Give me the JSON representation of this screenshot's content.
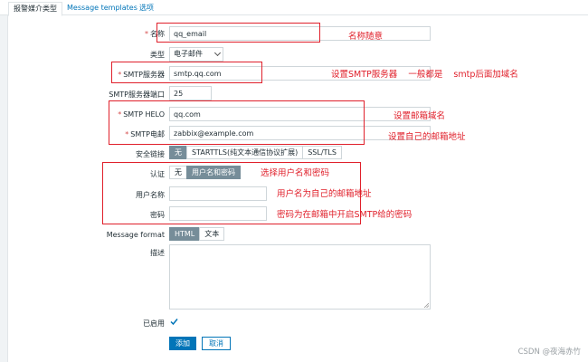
{
  "tabs": [
    {
      "label": "报警媒介类型",
      "active": true
    },
    {
      "label": "Message templates",
      "active": false
    },
    {
      "label": "选项",
      "active": false
    }
  ],
  "form": {
    "name": {
      "label": "名称",
      "value": "qq_email",
      "required": true
    },
    "type": {
      "label": "类型",
      "value": "电子邮件"
    },
    "smtp_server": {
      "label": "SMTP服务器",
      "value": "smtp.qq.com",
      "required": true
    },
    "smtp_port": {
      "label": "SMTP服务器端口",
      "value": "25"
    },
    "smtp_helo": {
      "label": "SMTP HELO",
      "value": "qq.com",
      "required": true
    },
    "smtp_email": {
      "label": "SMTP电邮",
      "value": "zabbix@example.com",
      "required": true
    },
    "security": {
      "label": "安全链接",
      "options": [
        "无",
        "STARTTLS(纯文本通信协议扩展)",
        "SSL/TLS"
      ],
      "selected": "无"
    },
    "auth": {
      "label": "认证",
      "options": [
        "无",
        "用户名和密码"
      ],
      "selected": "用户名和密码"
    },
    "username": {
      "label": "用户名称",
      "value": ""
    },
    "password": {
      "label": "密码",
      "value": ""
    },
    "message_format": {
      "label": "Message format",
      "options": [
        "HTML",
        "文本"
      ],
      "selected": "HTML"
    },
    "description": {
      "label": "描述",
      "value": ""
    },
    "enabled": {
      "label": "已启用",
      "checked": true
    }
  },
  "buttons": {
    "add": "添加",
    "cancel": "取消"
  },
  "annotations": {
    "name_note": "名称随意",
    "smtp_note": "设置SMTP服务器    一般都是    smtp后面加域名",
    "helo_note": "设置邮箱域名",
    "email_note": "设置自己的邮箱地址",
    "auth_note": "选择用户名和密码",
    "username_note": "用户名为自己的邮箱地址",
    "password_note": "密码为在邮箱中开启SMTP给的密码"
  },
  "watermark": "CSDN @夜海赤竹",
  "colors": {
    "accent": "#0275b8",
    "annotation": "#e0202b",
    "segment_on": "#768d99"
  }
}
